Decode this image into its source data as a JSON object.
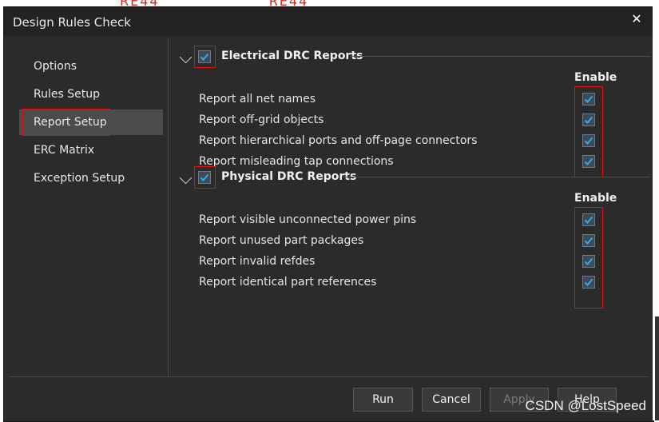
{
  "window": {
    "title": "Design Rules Check",
    "close_icon": "close-icon"
  },
  "background_text": {
    "left": "RE44",
    "right": "RE44"
  },
  "sidebar": {
    "items": [
      {
        "label": "Options",
        "active": false
      },
      {
        "label": "Rules Setup",
        "active": false
      },
      {
        "label": "Report Setup",
        "active": true
      },
      {
        "label": "ERC Matrix",
        "active": false
      },
      {
        "label": "Exception Setup",
        "active": false
      }
    ]
  },
  "sections": [
    {
      "title": "Electrical DRC Reports",
      "checked": true,
      "enable_header": "Enable",
      "rows": [
        {
          "label": "Report all net names",
          "enabled": true
        },
        {
          "label": "Report off-grid objects",
          "enabled": true
        },
        {
          "label": "Report hierarchical ports and off-page connectors",
          "enabled": true
        },
        {
          "label": "Report misleading tap connections",
          "enabled": true
        }
      ]
    },
    {
      "title": "Physical DRC Reports",
      "checked": true,
      "enable_header": "Enable",
      "rows": [
        {
          "label": "Report visible unconnected power pins",
          "enabled": true
        },
        {
          "label": "Report unused part packages",
          "enabled": true
        },
        {
          "label": "Report invalid refdes",
          "enabled": true
        },
        {
          "label": "Report identical part references",
          "enabled": true
        }
      ]
    }
  ],
  "buttons": {
    "run": "Run",
    "cancel": "Cancel",
    "apply": "Apply",
    "help": "Help"
  },
  "watermark": "CSDN @LostSpeed",
  "colors": {
    "dialog_bg": "#2b2b2b",
    "accent_check": "#38a9e8",
    "highlight_box": "#e01010"
  }
}
